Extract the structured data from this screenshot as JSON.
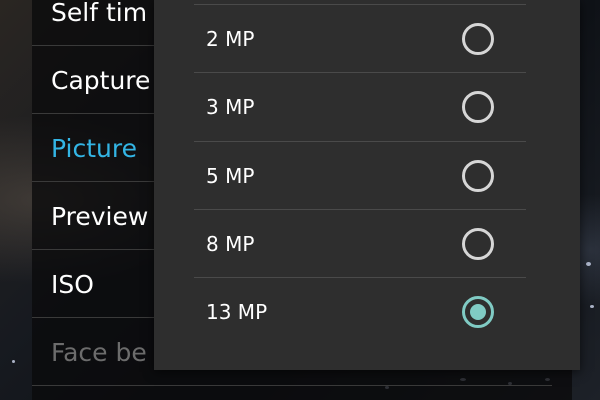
{
  "settings": {
    "items": [
      {
        "label": "Self tim",
        "state": "normal"
      },
      {
        "label": "Capture",
        "state": "normal"
      },
      {
        "label": "Picture",
        "state": "selected"
      },
      {
        "label": "Preview",
        "state": "normal"
      },
      {
        "label": "ISO",
        "state": "normal"
      },
      {
        "label": "Face be",
        "state": "disabled"
      }
    ]
  },
  "dialog": {
    "options": [
      {
        "label": "2 MP",
        "checked": false
      },
      {
        "label": "3 MP",
        "checked": false
      },
      {
        "label": "5 MP",
        "checked": false
      },
      {
        "label": "8 MP",
        "checked": false
      },
      {
        "label": "13 MP",
        "checked": true
      }
    ]
  },
  "colors": {
    "accent_selected": "#33b5e5",
    "radio_checked": "#80cbc4"
  }
}
